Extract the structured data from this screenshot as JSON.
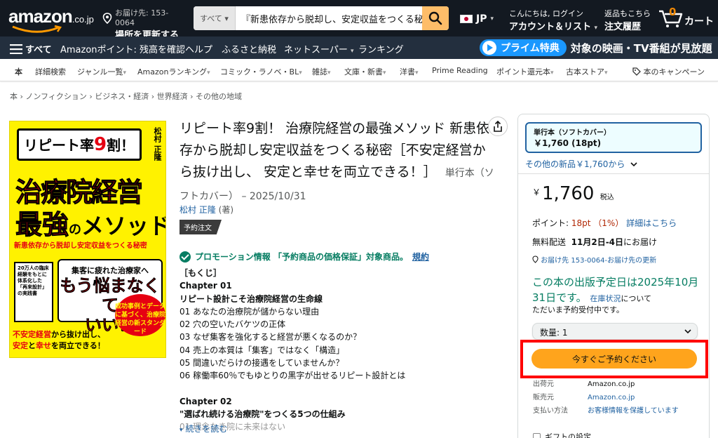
{
  "header": {
    "logo": "amazon",
    "logo_suffix": ".co.jp",
    "deliver_line1": "お届け先: 153-0064",
    "deliver_line2": "場所を更新する",
    "search_category": "すべて",
    "search_query": "『新患依存から脱却し、安定収益をつくる秘",
    "lang": "JP",
    "account_line1": "こんにちは, ログイン",
    "account_line2": "アカウント＆リスト",
    "orders_line1": "返品もこちら",
    "orders_line2": "注文履歴",
    "cart_count": "0",
    "cart_label": "カート"
  },
  "nav_main": {
    "menu": "すべて",
    "items": [
      "Amazonポイント: 残高を確認",
      "ヘルプ",
      "ふるさと納税",
      "ネットスーパー",
      "ランキング"
    ],
    "prime_label": "プライム特典",
    "prime_text": "対象の映画・TV番組が見放題"
  },
  "subnav": {
    "items": [
      "本",
      "詳細検索",
      "ジャンル一覧",
      "Amazonランキング",
      "コミック・ラノベ・BL",
      "雑誌",
      "文庫・新書",
      "洋書",
      "Prime Reading",
      "ポイント還元本",
      "古本ストア",
      "本のキャンペーン"
    ]
  },
  "breadcrumb": "本 › ノンフィクション › ビジネス・経済 › 世界経済 › その他の地域",
  "cover": {
    "top": "リピート率",
    "top_num": "9",
    "top_end": "割！",
    "author": "松村 正隆",
    "title1": "治療院経営",
    "title2a": "最強",
    "title2b": "の",
    "title2c": "メソッド",
    "subtitle": "新患依存から脱却し安定収益をつくる秘密",
    "box_a": "集客に疲れた治療家へ",
    "box_b1": "もう悩まなくて",
    "box_b2": "いい！",
    "left_text": "20万人の臨床経験をもとに体系化した「再来設計」の実践書",
    "badge": "成功事例とデータに基づく、治療院経営の新スタンダード",
    "bottom1a": "不安定経営",
    "bottom1b": "から抜け出し、",
    "bottom2a": "安定",
    "bottom2b": "と",
    "bottom2c": "幸せ",
    "bottom2d": "を両立できる！"
  },
  "product": {
    "title": "リピート率9割！ 治療院経営の最強メソッド 新患依存から脱却し安定収益をつくる秘密［不安定経営から抜け出し、 安定と幸せを両立できる！］",
    "format_meta": "単行本（ソフトカバー） – 2025/10/31",
    "author_name": "松村 正隆",
    "author_role": "(著)",
    "tag": "予約注文",
    "promo_text": "プロモーション情報 「予約商品の価格保証」対象商品。",
    "promo_link": "規約",
    "toc": [
      {
        "text": "［もくじ］",
        "bold": true
      },
      {
        "text": "Chapter 01",
        "bold": true
      },
      {
        "text": "リピート設計こそ治療院経営の生命線",
        "bold": true
      },
      {
        "text": "01 あなたの治療院が儲からない理由",
        "bold": false
      },
      {
        "text": "02 穴の空いたバケツの正体",
        "bold": false
      },
      {
        "text": "03 なぜ集客を強化すると経営が悪くなるのか？",
        "bold": false
      },
      {
        "text": "04 売上の本質は「集客」ではなく「構造」",
        "bold": false
      },
      {
        "text": "05 間違いだらけの接遇をしていませんか？",
        "bold": false
      },
      {
        "text": "06 稼働率60％でもゆとりの黒字が出せるリピート設計とは",
        "bold": false
      }
    ],
    "toc2": [
      {
        "text": "Chapter 02",
        "bold": true
      },
      {
        "text": "\"選ばれ続ける治療院\"をつくる5つの仕組み",
        "bold": true
      },
      {
        "text": "01 理念なき院に未来はない",
        "bold": false
      }
    ],
    "read_more": "続きを読む"
  },
  "buybox": {
    "format_name": "単行本（ソフトカバー）",
    "format_price": "￥1,760 (18pt)",
    "other_new": "その他の新品￥1,760から",
    "price_symbol": "￥",
    "price": "1,760",
    "tax": "税込",
    "points_label": "ポイント:",
    "points_value": "18pt （1%）",
    "points_link": "詳細はこちら",
    "ship_label": "無料配送",
    "ship_date": "11月2日-4日",
    "ship_suffix": "にお届け",
    "address": "お届け先 153-0064-お届け先の更新",
    "release": "この本の出版予定日は2025年10月31日です。",
    "stock_link": "在庫状況",
    "stock_suffix": "について",
    "avail": "ただいま予約受付中です。",
    "qty": "数量: 1",
    "preorder": "今すぐご予約ください",
    "info": [
      {
        "k": "出荷元",
        "v": "Amazon.co.jp",
        "link": false
      },
      {
        "k": "販売元",
        "v": "Amazon.co.jp",
        "link": true
      },
      {
        "k": "支払い方法",
        "v": "お客様情報を保護しています",
        "link": true
      }
    ],
    "gift": "ギフトの設定"
  },
  "colors": {
    "nav_dark": "#131921",
    "nav_secondary": "#232f3e",
    "search_button": "#febd69",
    "preorder_button": "#ffa41c",
    "highlight": "#ff0000",
    "prime_blue": "#1a98ff",
    "availability_green": "#067d62"
  }
}
